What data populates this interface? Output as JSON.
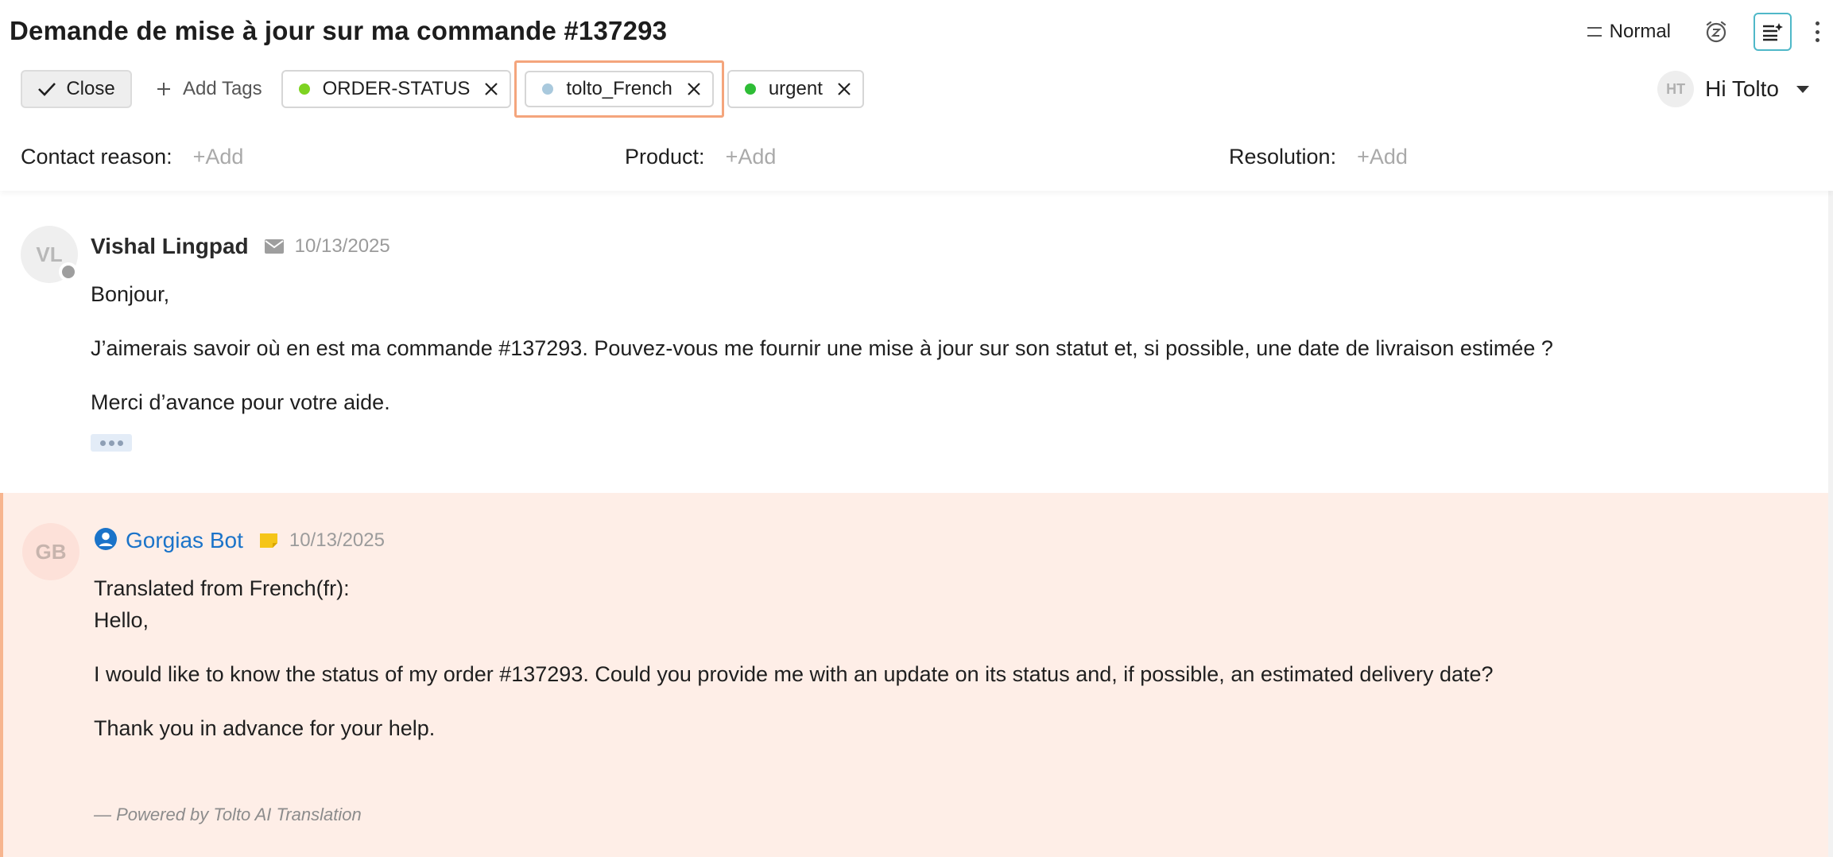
{
  "header": {
    "title": "Demande de mise à jour sur ma commande #137293",
    "priority_label": "Normal",
    "close_label": "Close",
    "add_tags_label": "Add Tags",
    "tags": [
      {
        "label": "ORDER-STATUS",
        "color": "#7ed321"
      },
      {
        "label": "tolto_French",
        "color": "#a9c9dd"
      },
      {
        "label": "urgent",
        "color": "#2ebd36"
      }
    ],
    "user": {
      "initials": "HT",
      "name": "Hi Tolto"
    },
    "fields": [
      {
        "label": "Contact reason:",
        "placeholder": "+Add"
      },
      {
        "label": "Product:",
        "placeholder": "+Add"
      },
      {
        "label": "Resolution:",
        "placeholder": "+Add"
      }
    ]
  },
  "messages": [
    {
      "initials": "VL",
      "sender": "Vishal Lingpad",
      "channel_icon": "email-icon",
      "date": "10/13/2025",
      "lines": [
        "Bonjour,",
        "J’aimerais savoir où en est ma commande #137293. Pouvez-vous me fournir une mise à jour sur son statut et, si possible, une date de livraison estimée ?",
        "Merci d’avance pour votre aide."
      ]
    },
    {
      "initials": "GB",
      "sender": "Gorgias Bot",
      "channel_icon": "internal-note-icon",
      "date": "10/13/2025",
      "translated_header": "Translated from French(fr):",
      "lines": [
        "Hello,",
        "I would like to know the status of my order #137293. Could you provide me with an update on its status and, if possible, an estimated delivery date?",
        "Thank you in advance for your help."
      ],
      "footer": "— Powered by Tolto AI Translation"
    }
  ],
  "colors": {
    "bot_name": "#1a73c9",
    "bot_bg": "#feeee7",
    "highlight_border": "#f4a57c",
    "panel_toggle_border": "#4fb8c8"
  }
}
